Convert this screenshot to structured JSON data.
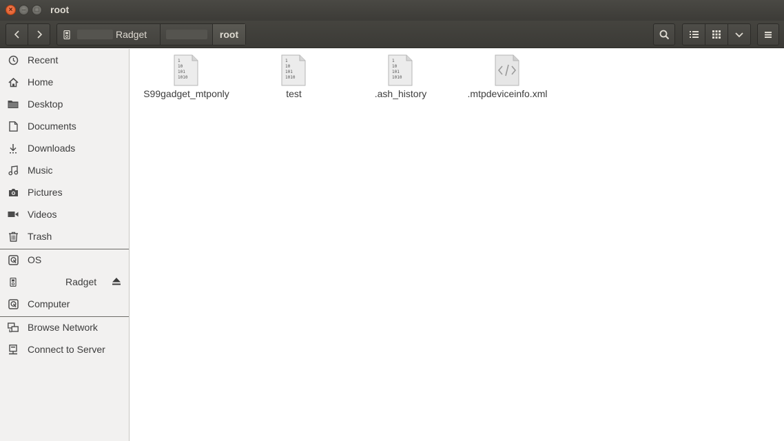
{
  "window": {
    "title": "root"
  },
  "toolbar": {
    "path": {
      "device_label": "Radget",
      "current": "root"
    }
  },
  "sidebar": {
    "places": [
      {
        "label": "Recent",
        "icon": "clock-icon"
      },
      {
        "label": "Home",
        "icon": "home-icon"
      },
      {
        "label": "Desktop",
        "icon": "folder-icon"
      },
      {
        "label": "Documents",
        "icon": "document-icon"
      },
      {
        "label": "Downloads",
        "icon": "download-icon"
      },
      {
        "label": "Music",
        "icon": "music-icon"
      },
      {
        "label": "Pictures",
        "icon": "camera-icon"
      },
      {
        "label": "Videos",
        "icon": "video-icon"
      },
      {
        "label": "Trash",
        "icon": "trash-icon"
      }
    ],
    "devices": [
      {
        "label": "OS",
        "icon": "drive-icon"
      },
      {
        "label": "Radget",
        "icon": "media-player-icon"
      },
      {
        "label": "Computer",
        "icon": "computer-icon"
      }
    ],
    "network": [
      {
        "label": "Browse Network",
        "icon": "network-icon"
      },
      {
        "label": "Connect to Server",
        "icon": "server-icon"
      }
    ]
  },
  "files": [
    {
      "name": "S99gadget_mtponly",
      "icon": "binary-file-icon"
    },
    {
      "name": "test",
      "icon": "binary-file-icon"
    },
    {
      "name": ".ash_history",
      "icon": "binary-file-icon"
    },
    {
      "name": ".mtpdeviceinfo.xml",
      "icon": "xml-file-icon"
    }
  ]
}
